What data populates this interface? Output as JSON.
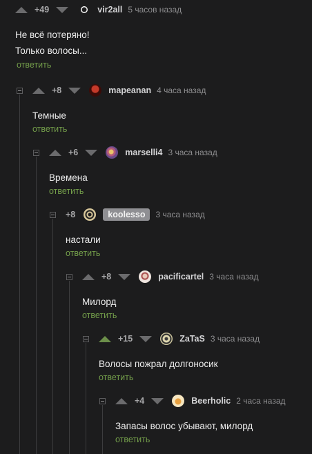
{
  "comments": [
    {
      "rating": "+49",
      "user": "vir2all",
      "time": "5 часов назад",
      "lines": [
        "Не всё потеряно!",
        "Только волосы..."
      ],
      "reply": "ответить"
    },
    {
      "rating": "+8",
      "user": "mapeanan",
      "time": "4 часа назад",
      "lines": [
        "Темные"
      ],
      "reply": "ответить"
    },
    {
      "rating": "+6",
      "user": "marselli4",
      "time": "3 часа назад",
      "lines": [
        "Времена"
      ],
      "reply": "ответить"
    },
    {
      "rating": "+8",
      "user": "koolesso",
      "time": "3 часа назад",
      "lines": [
        "настали"
      ],
      "reply": "ответить"
    },
    {
      "rating": "+8",
      "user": "pacificartel",
      "time": "3 часа назад",
      "lines": [
        "Милорд"
      ],
      "reply": "ответить"
    },
    {
      "rating": "+15",
      "user": "ZaTaS",
      "time": "3 часа назад",
      "lines": [
        "Волосы пожрал долгоносик"
      ],
      "reply": "ответить"
    },
    {
      "rating": "+4",
      "user": "Beerholic",
      "time": "2 часа назад",
      "lines": [
        "Запасы волос убывают, милорд"
      ],
      "reply": "ответить"
    }
  ],
  "colors": {
    "background": "#1c1c1d",
    "reply_link": "#739d4a",
    "upvote_active": "#6c8f4a"
  },
  "icons": {
    "collapse": "collapse-minus-icon",
    "upvote": "upvote-arrow-icon",
    "downvote": "downvote-arrow-icon"
  }
}
